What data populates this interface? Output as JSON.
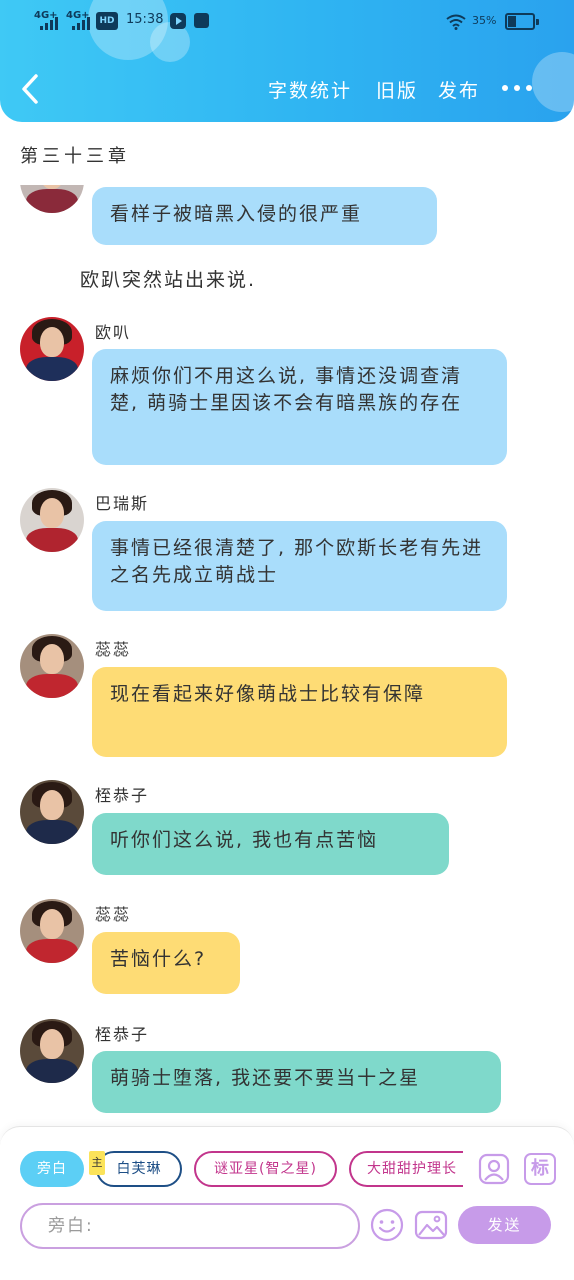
{
  "statusbar": {
    "net1": "4G+",
    "net2": "4G+",
    "hd": "HD",
    "time": "15:38",
    "battery": "35%"
  },
  "header": {
    "back_icon": "chevron-left-icon",
    "word_count": "字数统计",
    "old_version": "旧版",
    "publish": "发布",
    "more_icon": "more-dots-icon"
  },
  "chapter_title": "第三十三章",
  "messages": [
    {
      "speaker": "",
      "text": "看样子被暗黑入侵的很严重",
      "color": "blue"
    },
    {
      "narration": "欧趴突然站出来说."
    },
    {
      "speaker": "欧叭",
      "text": "麻烦你们不用这么说, 事情还没调查清楚, 萌骑士里因该不会有暗黑族的存在",
      "color": "blue"
    },
    {
      "speaker": "巴瑞斯",
      "text": "事情已经很清楚了, 那个欧斯长老有先进之名先成立萌战士",
      "color": "blue"
    },
    {
      "speaker": "蕊蕊",
      "text": "现在看起来好像萌战士比较有保障",
      "color": "yellow"
    },
    {
      "speaker": "桎恭子",
      "text": "听你们这么说, 我也有点苦恼",
      "color": "teal"
    },
    {
      "speaker": "蕊蕊",
      "text": "苦恼什么?",
      "color": "yellow"
    },
    {
      "speaker": "桎恭子",
      "text": "萌骑士堕落, 我还要不要当十之星",
      "color": "teal"
    }
  ],
  "roles": {
    "narration": "旁白",
    "main_tag": "主",
    "role1": "白芙琳",
    "role2": "谜亚星(智之星)",
    "role3": "大甜甜护理长"
  },
  "composer": {
    "placeholder": "旁白:",
    "send": "发送",
    "emoji_icon": "emoji-icon",
    "image_icon": "image-icon",
    "role_icon": "role-portrait-icon",
    "tag_icon": "tag-icon",
    "tag_label": "标"
  },
  "colors": {
    "header": "#2fb4f2",
    "bubble_blue": "#a9ddfb",
    "bubble_yellow": "#fedc75",
    "bubble_teal": "#7fd9cb",
    "send": "#c79be9"
  }
}
